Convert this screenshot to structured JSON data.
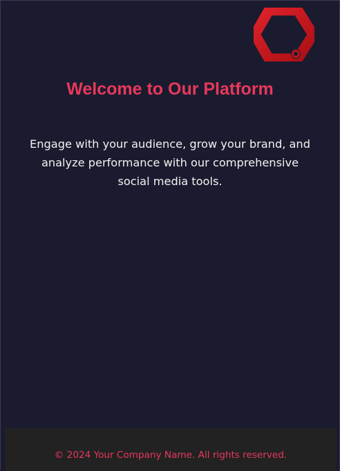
{
  "colors": {
    "background": "#1b1b2f",
    "accent": "#e8385b",
    "logo_red": "#d0151c",
    "footer_bg": "#222222",
    "text_light": "#f2f2f2"
  },
  "logo": {
    "icon": "hexagon-logo-icon"
  },
  "hero": {
    "title": "Welcome to Our Platform",
    "description": "Engage with your audience, grow your brand, and analyze performance with our comprehensive social media tools."
  },
  "footer": {
    "copyright": "© 2024 Your Company Name. All rights reserved."
  }
}
